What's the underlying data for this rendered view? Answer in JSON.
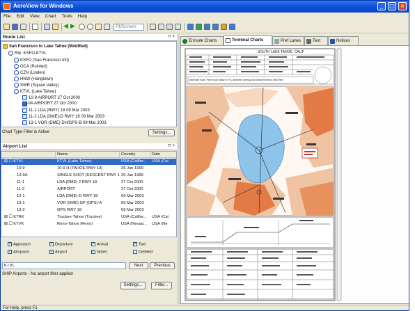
{
  "window": {
    "title": "AeroView for Windows"
  },
  "menu": [
    "File",
    "Edit",
    "View",
    "Chart",
    "Tools",
    "Help"
  ],
  "toolbar": {
    "zoom_combo": "Fit/Screen"
  },
  "route_panel": {
    "header": "Route List",
    "root": "San Francisco to Lake Tahoe (Modified)",
    "route_id": "Rte: KSFO-KTVL",
    "items": [
      {
        "label": "KSFO (San Francisco Intl)",
        "kind": "wp"
      },
      {
        "label": "OCA (Pointed)",
        "kind": "wp"
      },
      {
        "label": "CZN (Linden)",
        "kind": "wp"
      },
      {
        "label": "HNW (Hangtown)",
        "kind": "wp"
      },
      {
        "label": "SWR (Squaw Valley)",
        "kind": "wp"
      },
      {
        "label": "KTVL (Lake Tahoe)",
        "kind": "wp"
      },
      {
        "label": "10-9   AIRPORT   27 Oct 2000",
        "kind": "doc"
      },
      {
        "label": "10-9A   AIRPORT   27 Oct 2000",
        "kind": "chk"
      },
      {
        "label": "11-1   LDA (RWY) 18   09 Mar 2003",
        "kind": "doc"
      },
      {
        "label": "11-2   LDA (DME)-D RWY 18   09 Mar 2003",
        "kind": "doc"
      },
      {
        "label": "13-1   VOR (DME) DH/GPS-B   09 Mar 2003",
        "kind": "doc"
      }
    ],
    "filter_label": "Chart Type Filter is Active",
    "settings_btn": "Settings..."
  },
  "airport_panel": {
    "header": "Airport List",
    "columns": [
      "Name",
      "Country",
      "Date"
    ],
    "rows": [
      {
        "id": "KTVL",
        "name": "KTVL (Lake Tahoe)",
        "country": "USA (Califor...",
        "date": "USA (Cal",
        "selected": true
      },
      {
        "id": "10-9",
        "name": "10-9 H (TAHOE RWY 18)",
        "country": "26 Jan 1999",
        "date": ""
      },
      {
        "id": "10-9A",
        "name": "SINGLE SHOT (DESCENT RWY 18)",
        "country": "26 Jan 1999",
        "date": ""
      },
      {
        "id": "11-1",
        "name": "LDA (DME) 2 RWY 18",
        "country": "27 Oct 2000",
        "date": ""
      },
      {
        "id": "11-2",
        "name": "AIRPORT",
        "country": "27 Oct 2000",
        "date": ""
      },
      {
        "id": "12-1",
        "name": "LDA (DME)-D RWY 18",
        "country": "09 Mar 2003",
        "date": ""
      },
      {
        "id": "13-1",
        "name": "VOR (DME) GP (GPS)-A",
        "country": "09 Mar 2003",
        "date": ""
      },
      {
        "id": "13-2",
        "name": "GPS RWY 18",
        "country": "09 Mar 2003",
        "date": ""
      },
      {
        "id": "KTRK",
        "name": "Truckee-Tahoe (Truckee)",
        "country": "USA (Califor...",
        "date": "USA (Cal"
      },
      {
        "id": "KTVK",
        "name": "Reno-Tahoe (Reno)",
        "country": "USA (Nevad...",
        "date": "USA (Ne"
      }
    ],
    "checks": [
      {
        "label": "Approach",
        "checked": true
      },
      {
        "label": "Departure",
        "checked": true
      },
      {
        "label": "Arrival",
        "checked": true
      },
      {
        "label": "Taxi",
        "checked": true
      },
      {
        "label": "Airspace",
        "checked": true
      },
      {
        "label": "Airport",
        "checked": true
      },
      {
        "label": "Notes",
        "checked": true
      },
      {
        "label": "Deleted",
        "checked": false
      }
    ],
    "search_value": "KTVL",
    "next_btn": "Next",
    "prev_btn": "Previous",
    "status": "SHIP Airports - No airport filter applied",
    "settings_btn": "Settings...",
    "filter_btn": "Filter..."
  },
  "tabs": [
    "Enroute Charts",
    "Terminal Charts",
    "Pref Lanes",
    "Text",
    "Notices"
  ],
  "active_tab": "Terminal Charts",
  "chart_plate": {
    "header": "SOUTH LAKE TAHOE, CALIF",
    "plate_title": "LAKE TAHOE",
    "notes": "Alternate Note: Pilot must obtain KTVL altimeter setting and descent below 5900 feet"
  },
  "statusbar": {
    "text": "For Help, press F1"
  }
}
